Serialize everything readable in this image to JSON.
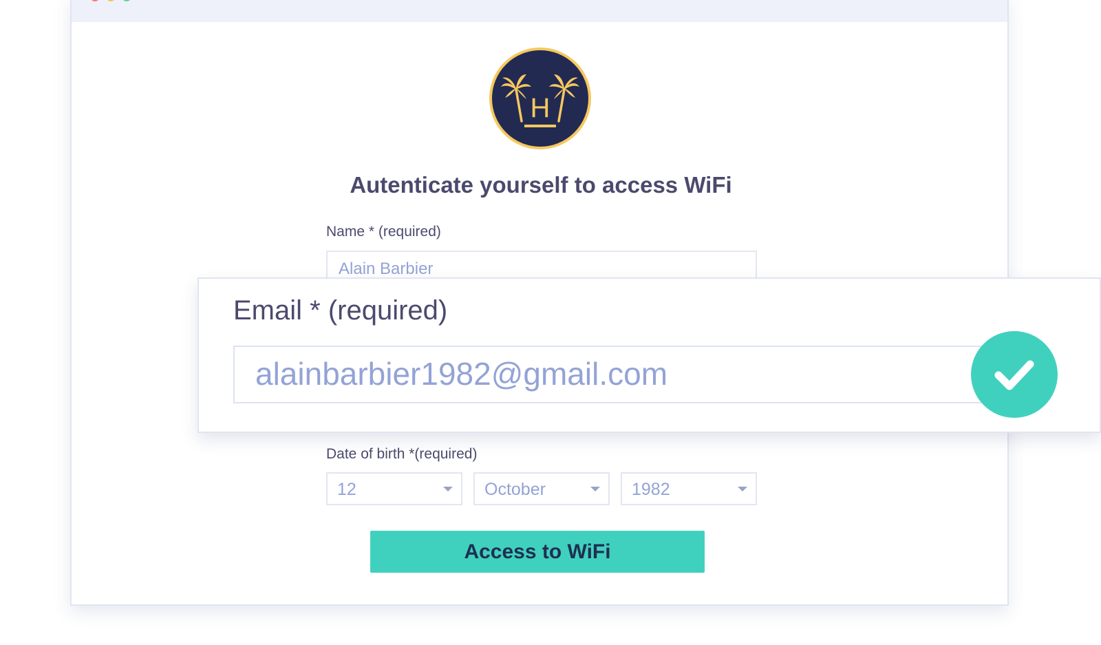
{
  "colors": {
    "accent": "#40d1be",
    "logo_navy": "#222a52",
    "logo_gold": "#f6c85f",
    "text": "#4b4a6d",
    "placeholder": "#93a3d6",
    "dot_red": "#f47a7a",
    "dot_yellow": "#f6c350",
    "dot_green": "#5dd39e"
  },
  "window": {
    "controls": [
      "close-dot",
      "minimize-dot",
      "maximize-dot"
    ]
  },
  "logo": {
    "icon": "palm-trees-h-logo-icon",
    "letter": "H"
  },
  "form": {
    "heading": "Autenticate yourself to access WiFi",
    "name": {
      "label": "Name * (required)",
      "value": "Alain Barbier"
    },
    "email": {
      "label": "Email * (required)",
      "value": "alainbarbier1982@gmail.com",
      "status_icon": "checkmark-icon"
    },
    "dob": {
      "label": "Date of birth *(required)",
      "day": "12",
      "month": "October",
      "year": "1982"
    },
    "submit_label": "Access to WiFi"
  }
}
